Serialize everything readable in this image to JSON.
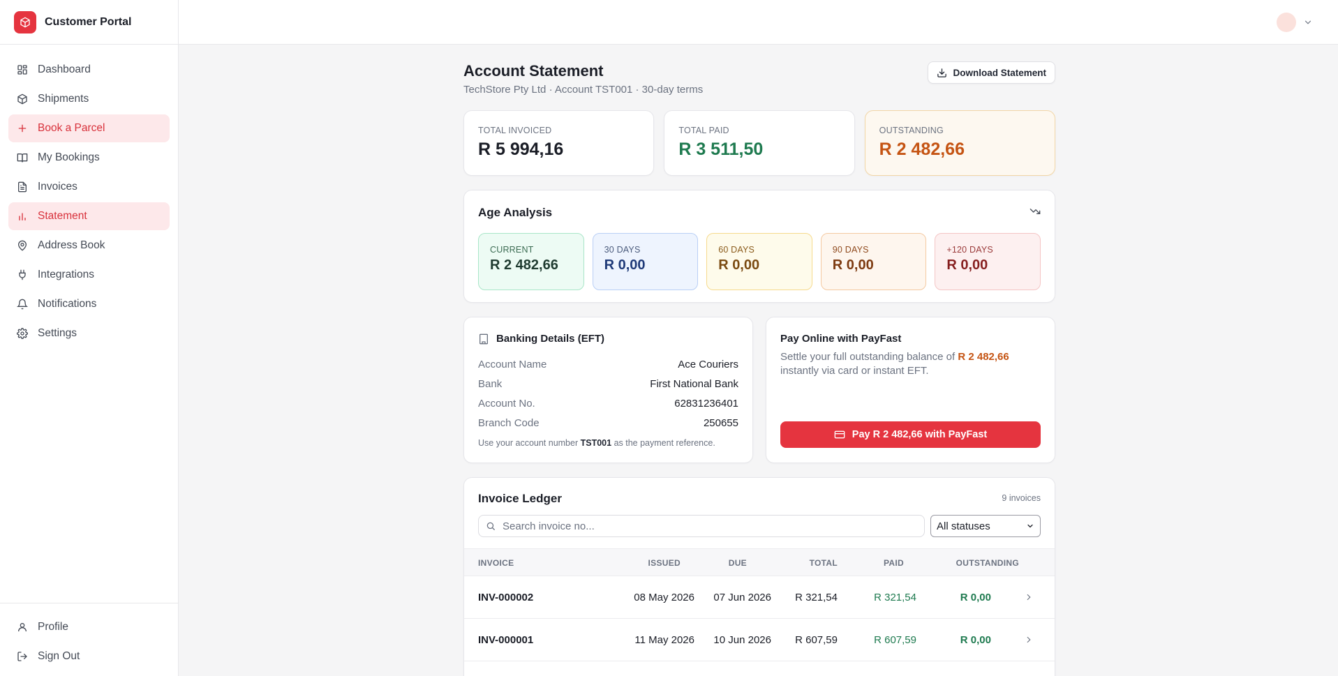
{
  "brand": {
    "title": "Customer Portal"
  },
  "nav": {
    "items": [
      {
        "label": "Dashboard",
        "icon": "grid-icon"
      },
      {
        "label": "Shipments",
        "icon": "package-icon"
      },
      {
        "label": "Book a Parcel",
        "icon": "plus-icon"
      },
      {
        "label": "My Bookings",
        "icon": "book-icon"
      },
      {
        "label": "Invoices",
        "icon": "file-icon"
      },
      {
        "label": "Statement",
        "icon": "bar-chart-icon"
      },
      {
        "label": "Address Book",
        "icon": "map-pin-icon"
      },
      {
        "label": "Integrations",
        "icon": "plug-icon"
      },
      {
        "label": "Notifications",
        "icon": "bell-icon"
      },
      {
        "label": "Settings",
        "icon": "gear-icon"
      }
    ],
    "bottom": [
      {
        "label": "Profile",
        "icon": "user-icon"
      },
      {
        "label": "Sign Out",
        "icon": "logout-icon"
      }
    ]
  },
  "page": {
    "title": "Account Statement",
    "subtitle": "TechStore Pty Ltd · Account TST001 · 30-day terms",
    "download_label": "Download Statement"
  },
  "kpis": {
    "total_invoiced": {
      "label": "TOTAL INVOICED",
      "value": "R 5 994,16"
    },
    "total_paid": {
      "label": "TOTAL PAID",
      "value": "R 3 511,50"
    },
    "outstanding": {
      "label": "OUTSTANDING",
      "value": "R 2 482,66"
    }
  },
  "age": {
    "title": "Age Analysis",
    "buckets": [
      {
        "label": "CURRENT",
        "value": "R 2 482,66"
      },
      {
        "label": "30 DAYS",
        "value": "R 0,00"
      },
      {
        "label": "60 DAYS",
        "value": "R 0,00"
      },
      {
        "label": "90 DAYS",
        "value": "R 0,00"
      },
      {
        "label": "+120 DAYS",
        "value": "R 0,00"
      }
    ]
  },
  "bank": {
    "title": "Banking Details (EFT)",
    "rows": [
      {
        "k": "Account Name",
        "v": "Ace Couriers"
      },
      {
        "k": "Bank",
        "v": "First National Bank"
      },
      {
        "k": "Account No.",
        "v": "62831236401"
      },
      {
        "k": "Branch Code",
        "v": "250655"
      }
    ],
    "note_prefix": "Use your account number",
    "note_ref": "TST001",
    "note_suffix": "as the payment reference."
  },
  "pay": {
    "title": "Pay Online with PayFast",
    "text_prefix": "Settle your full outstanding balance of",
    "amount": "R 2 482,66",
    "text_suffix": "instantly via card or instant EFT.",
    "button_label": "Pay R 2 482,66 with PayFast"
  },
  "ledger": {
    "title": "Invoice Ledger",
    "count": "9 invoices",
    "search_placeholder": "Search invoice no...",
    "status_filter": "All statuses",
    "columns": [
      "INVOICE",
      "ISSUED",
      "DUE",
      "TOTAL",
      "PAID",
      "OUTSTANDING"
    ],
    "rows": [
      {
        "invoice": "INV-000002",
        "issued": "08 May 2026",
        "due": "07 Jun 2026",
        "total": "R 321,54",
        "paid": "R 321,54",
        "outstanding": "R 0,00"
      },
      {
        "invoice": "INV-000001",
        "issued": "11 May 2026",
        "due": "10 Jun 2026",
        "total": "R 607,59",
        "paid": "R 607,59",
        "outstanding": "R 0,00"
      }
    ]
  },
  "colors": {
    "accent": "#e5343f",
    "paid_green": "#1e7a4f",
    "outstanding_orange": "#c55413"
  }
}
